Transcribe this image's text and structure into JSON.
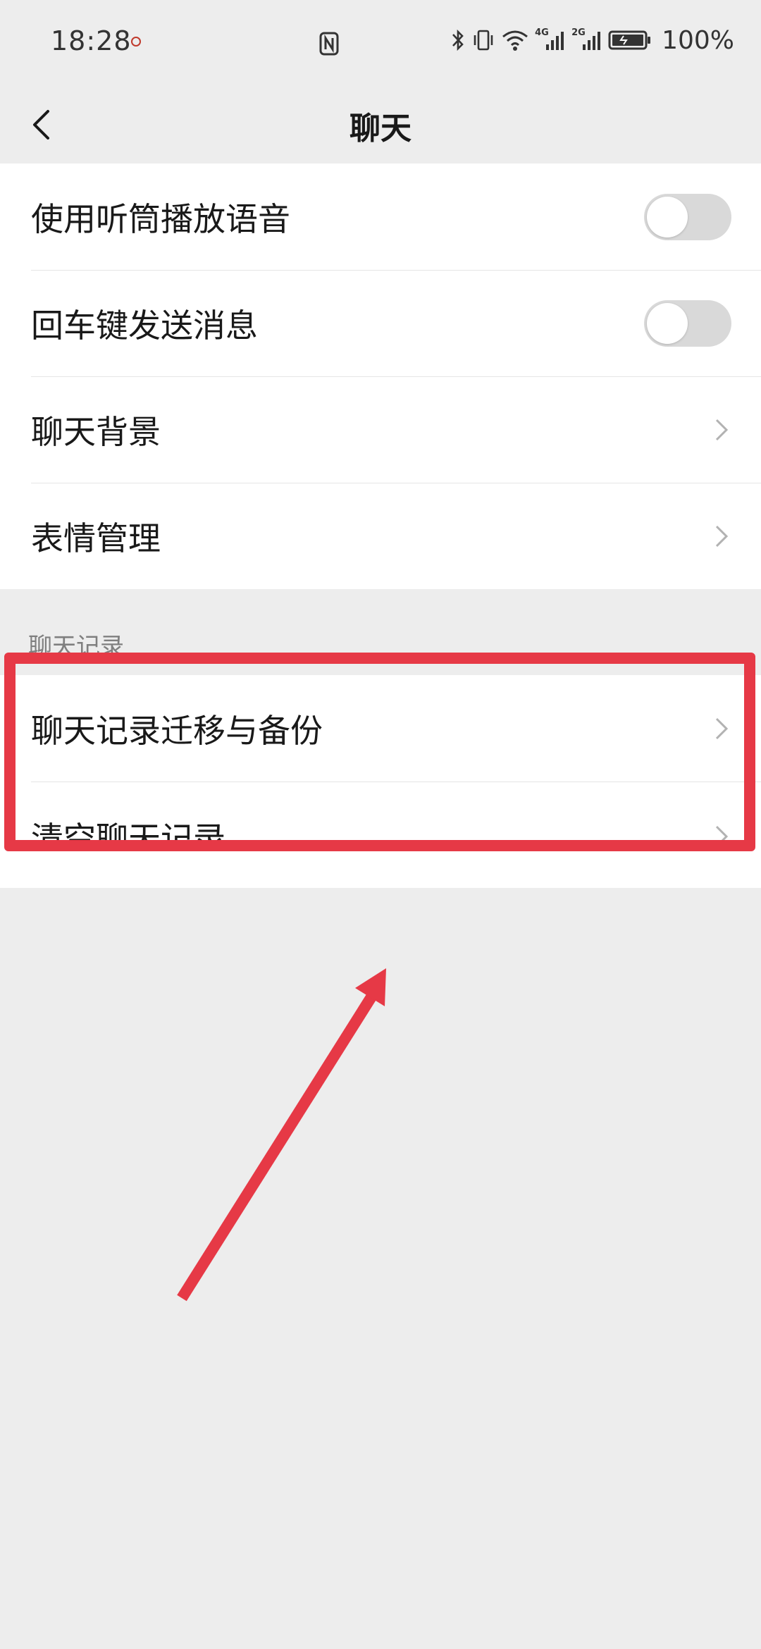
{
  "status_bar": {
    "time": "18:28",
    "network_4g": "4G",
    "network_2g": "2G",
    "battery_percent": "100%"
  },
  "nav": {
    "title": "聊天",
    "back_icon": "chevron-left-icon"
  },
  "settings": {
    "items": [
      {
        "label": "使用听筒播放语音",
        "control": "toggle",
        "on": false
      },
      {
        "label": "回车键发送消息",
        "control": "toggle",
        "on": false
      },
      {
        "label": "聊天背景",
        "control": "chevron"
      },
      {
        "label": "表情管理",
        "control": "chevron"
      }
    ]
  },
  "chat_history": {
    "section_title": "聊天记录",
    "items": [
      {
        "label": "聊天记录迁移与备份",
        "control": "chevron"
      },
      {
        "label": "清空聊天记录",
        "control": "chevron"
      }
    ]
  },
  "annotation": {
    "highlight_color": "#e63946",
    "arrow_color": "#e63946"
  },
  "colors": {
    "background": "#ededed",
    "cell": "#ffffff",
    "text": "#191919",
    "toggle_off": "#d9d9d9"
  }
}
